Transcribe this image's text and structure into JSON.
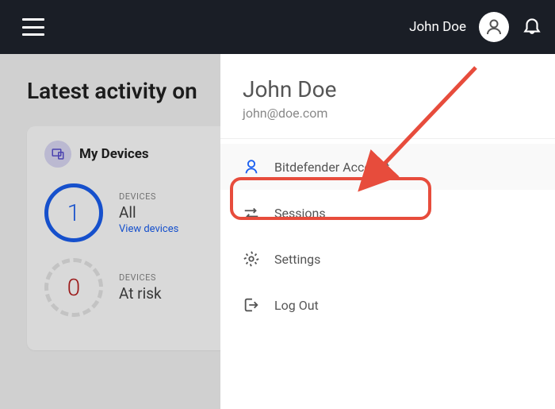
{
  "header": {
    "username": "John Doe"
  },
  "activity": {
    "title": "Latest activity on",
    "card_title": "My Devices",
    "stat_all": {
      "count": "1",
      "label": "DEVICES",
      "status": "All",
      "link": "View devices"
    },
    "stat_risk": {
      "count": "0",
      "label": "DEVICES",
      "status": "At risk"
    }
  },
  "panel": {
    "name": "John Doe",
    "email": "john@doe.com",
    "menu": {
      "account": "Bitdefender Account",
      "sessions": "Sessions",
      "settings": "Settings",
      "logout": "Log Out"
    }
  },
  "colors": {
    "accent_blue": "#1a5ff0",
    "accent_red": "#e74c3c",
    "header_bg": "#1a1e26"
  }
}
